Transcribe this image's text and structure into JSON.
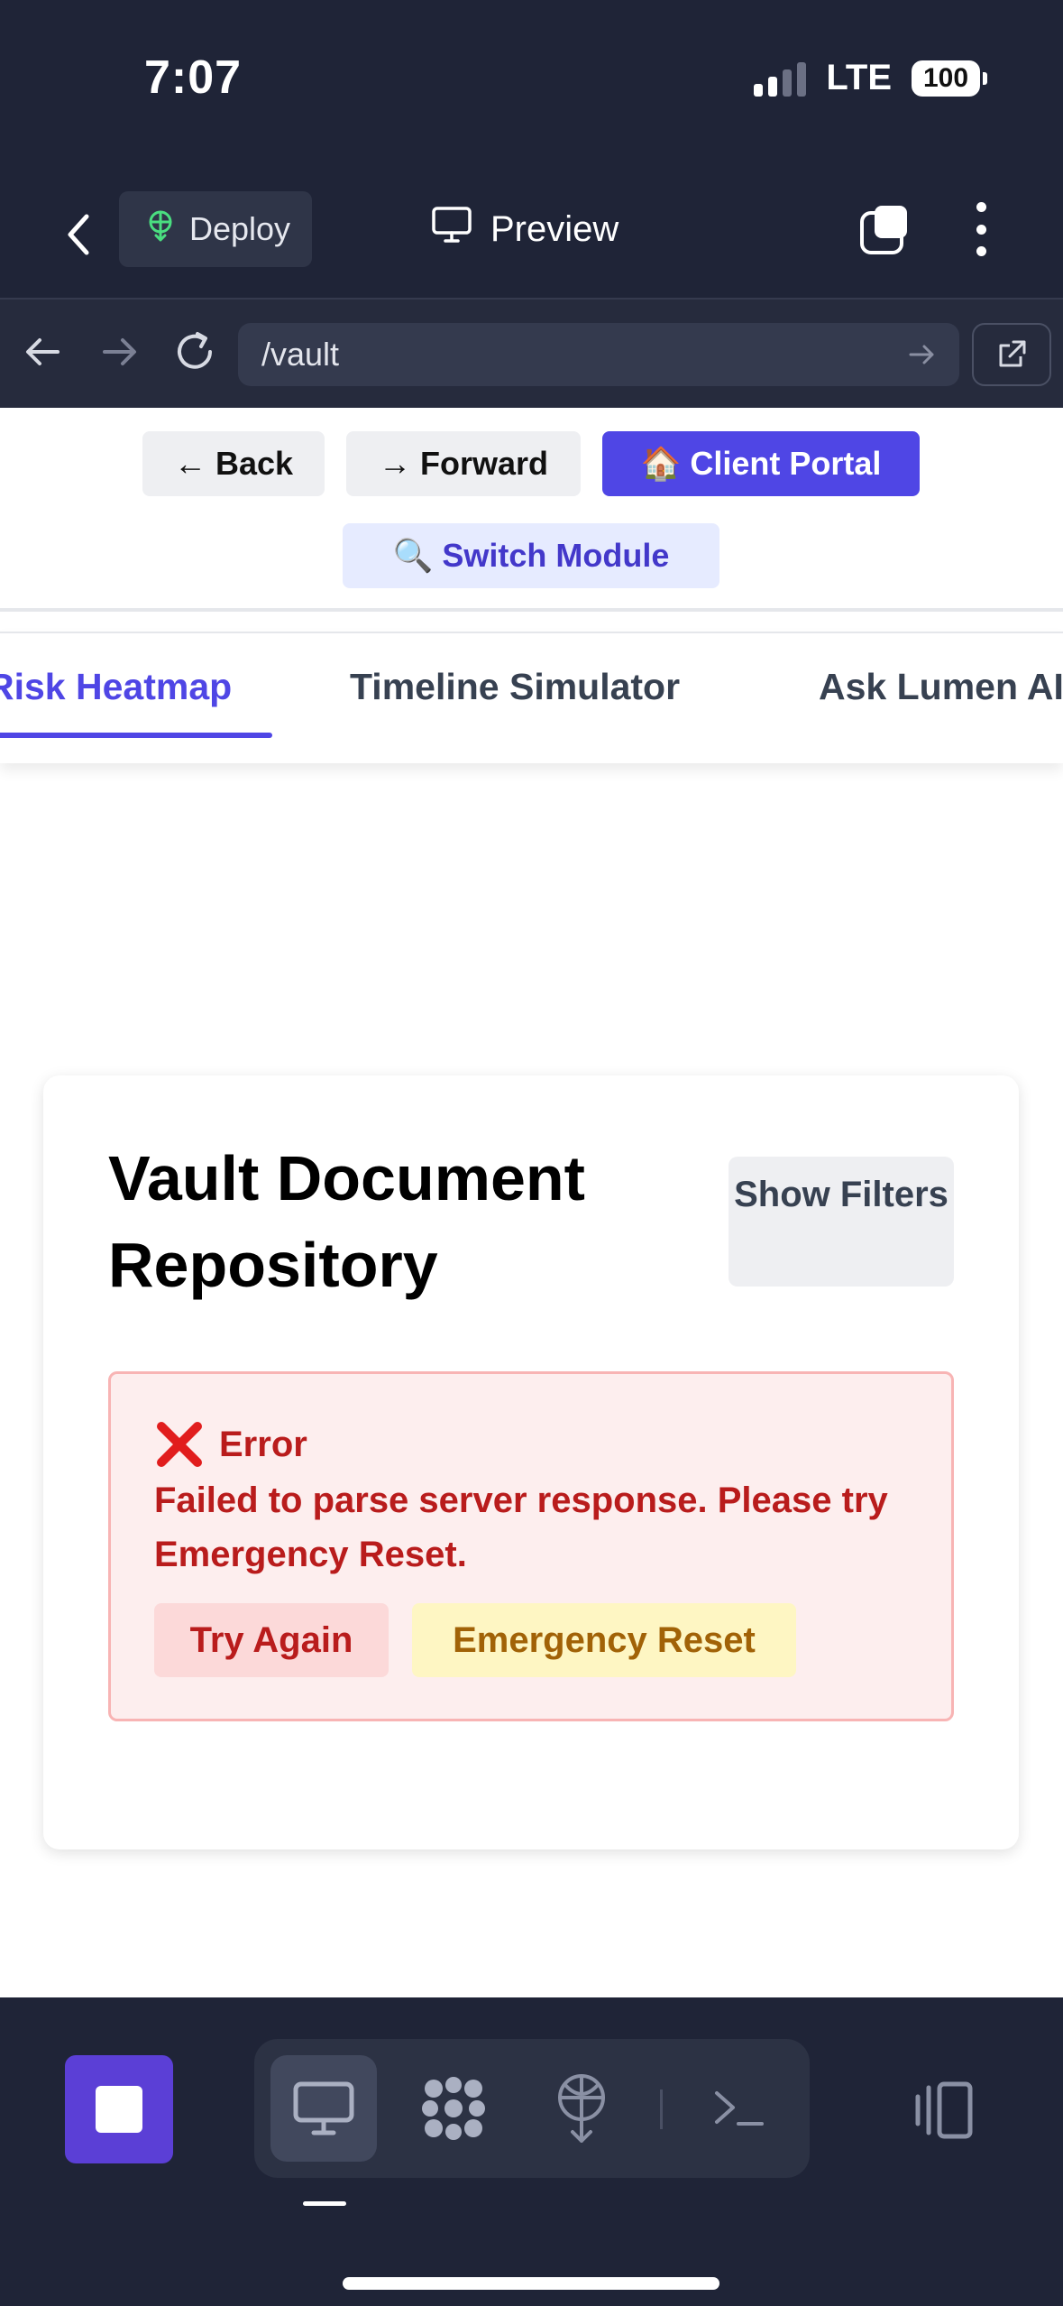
{
  "status_bar": {
    "time": "7:07",
    "network": "LTE",
    "battery": "100"
  },
  "toolbar": {
    "deploy_label": "Deploy",
    "preview_label": "Preview"
  },
  "url_bar": {
    "url": "/vault"
  },
  "page": {
    "nav": {
      "back_label": "← Back",
      "forward_label": "→ Forward",
      "portal_label": "🏠 Client Portal",
      "switch_label": "🔍 Switch Module"
    },
    "tabs": [
      {
        "label": "Risk Heatmap",
        "active": true
      },
      {
        "label": "Timeline Simulator",
        "active": false
      },
      {
        "label": "Ask Lumen AI",
        "active": false
      }
    ],
    "card": {
      "title": "Vault Document Repository",
      "filters_label": "Show Filters",
      "error": {
        "heading": "Error",
        "message": "Failed to parse server response. Please try Emergency Reset.",
        "retry_label": "Try Again",
        "reset_label": "Emergency Reset"
      }
    }
  },
  "colors": {
    "accent": "#4f46e5",
    "error": "#b91c1c",
    "warning": "#a16207",
    "chrome": "#1f2437"
  },
  "icons": [
    "chevron-left-icon",
    "deploy-icon",
    "monitor-icon",
    "tabs-icon",
    "more-vertical-icon",
    "arrow-left-icon",
    "arrow-right-icon",
    "reload-icon",
    "external-link-icon",
    "error-x-icon",
    "stop-icon",
    "desktop-icon",
    "packages-icon",
    "deploy-globe-icon",
    "terminal-icon",
    "sidebar-toggle-icon"
  ]
}
